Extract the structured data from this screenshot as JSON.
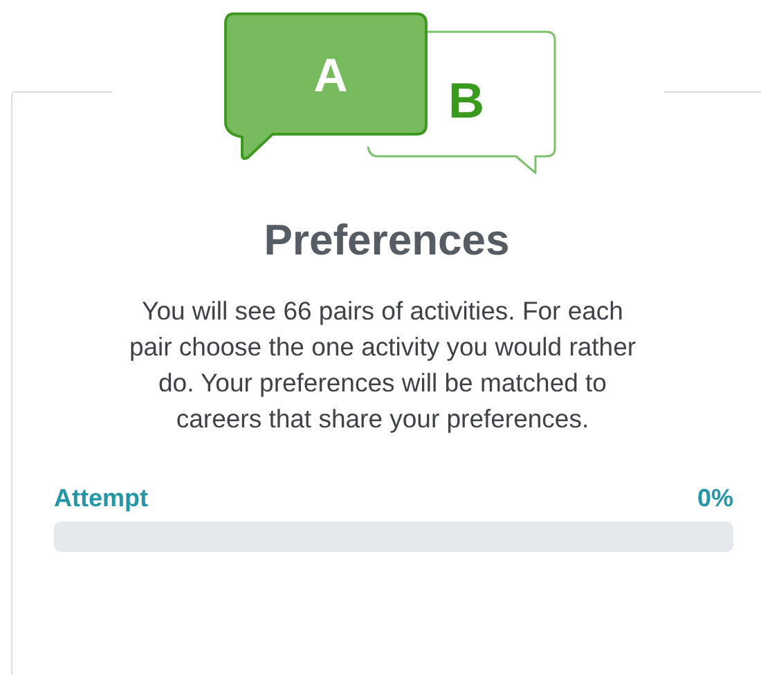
{
  "icon": {
    "letter_a": "A",
    "letter_b": "B"
  },
  "title": "Preferences",
  "description": "You will see 66 pairs of activities. For each pair choose the one activity you would rather do. Your preferences will be matched to careers that share your preferences.",
  "progress": {
    "label": "Attempt",
    "reading": "0%",
    "level": 0
  }
}
